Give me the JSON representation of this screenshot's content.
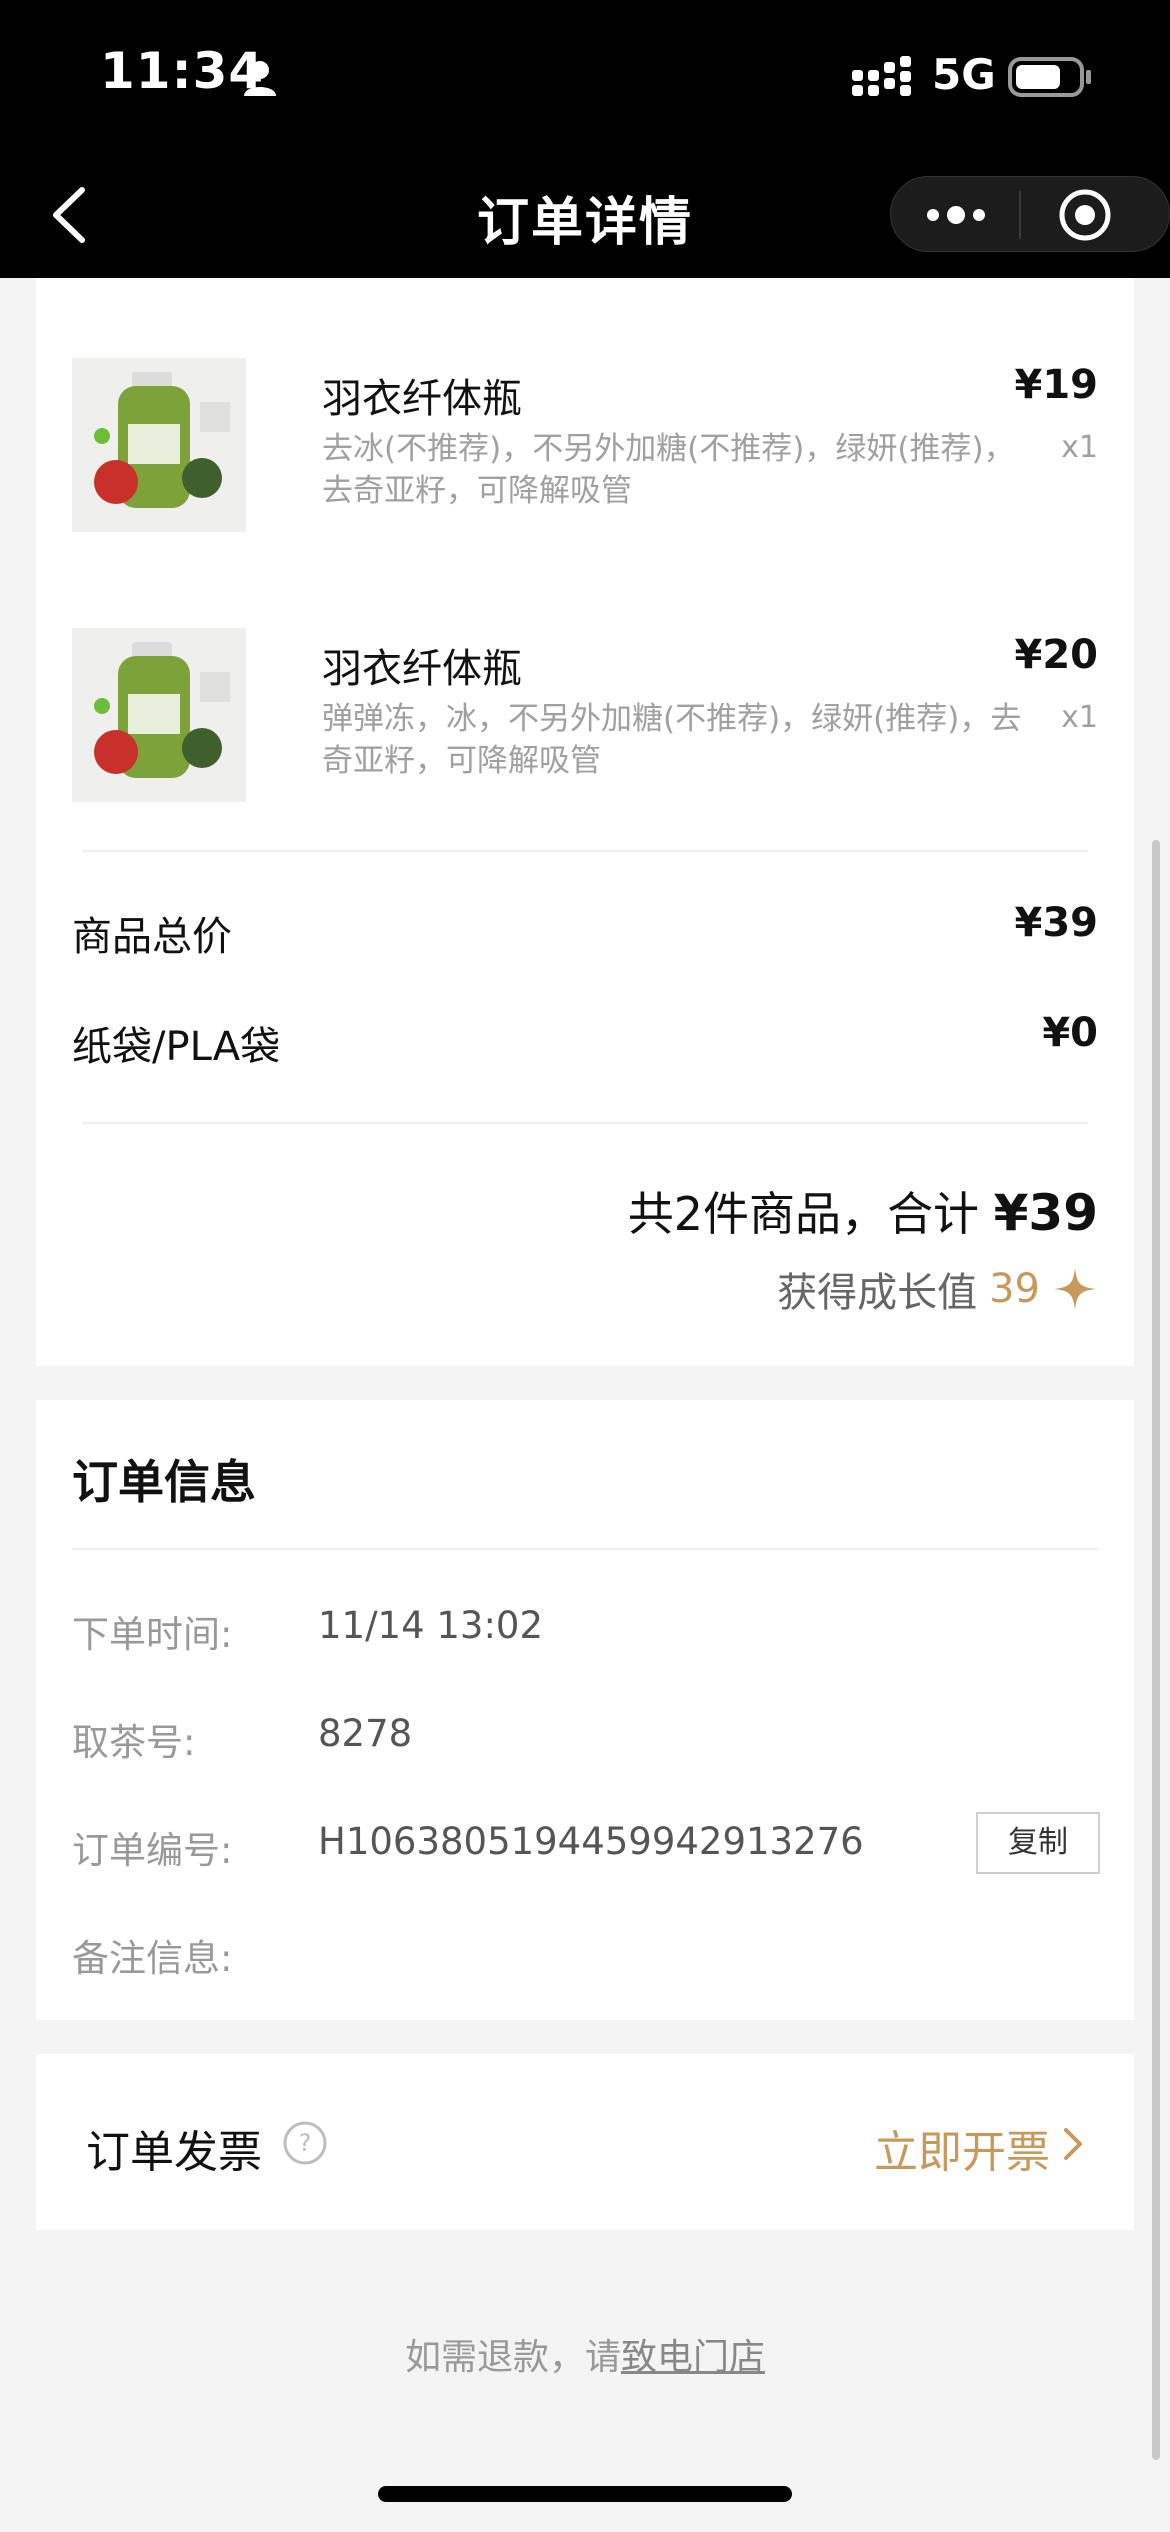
{
  "status_bar": {
    "time": "11:34",
    "network": "5G"
  },
  "nav": {
    "title": "订单详情"
  },
  "items": [
    {
      "name": "羽衣纤体瓶",
      "price": "¥19",
      "desc": "去冰(不推荐)，不另外加糖(不推荐)，绿妍(推荐)，去奇亚籽，可降解吸管",
      "qty": "x1",
      "image": "green-juice-bottle"
    },
    {
      "name": "羽衣纤体瓶",
      "price": "¥20",
      "desc": "弹弹冻，冰，不另外加糖(不推荐)，绿妍(推荐)，去奇亚籽，可降解吸管",
      "qty": "x1",
      "image": "green-juice-bottle"
    }
  ],
  "summary": {
    "goods_total_label": "商品总价",
    "goods_total_value": "¥39",
    "bag_label": "纸袋/PLA袋",
    "bag_value": "¥0",
    "count_text": "共2件商品，合计 ",
    "total_amount": "¥39",
    "growth_label": "获得成长值",
    "growth_value": "39"
  },
  "order_info": {
    "title": "订单信息",
    "time_label": "下单时间:",
    "time_value": "11/14 13:02",
    "pickup_label": "取茶号:",
    "pickup_value": "8278",
    "order_no_label": "订单编号:",
    "order_no_value": "H1063805194459942913276",
    "copy_label": "复制",
    "remark_label": "备注信息:",
    "remark_value": ""
  },
  "invoice": {
    "label": "订单发票",
    "action": "立即开票"
  },
  "refund": {
    "text": "如需退款，请",
    "link": "致电门店"
  },
  "colors": {
    "accent": "#c79a5c",
    "bar": "#000000",
    "background": "#f4f4f4"
  }
}
